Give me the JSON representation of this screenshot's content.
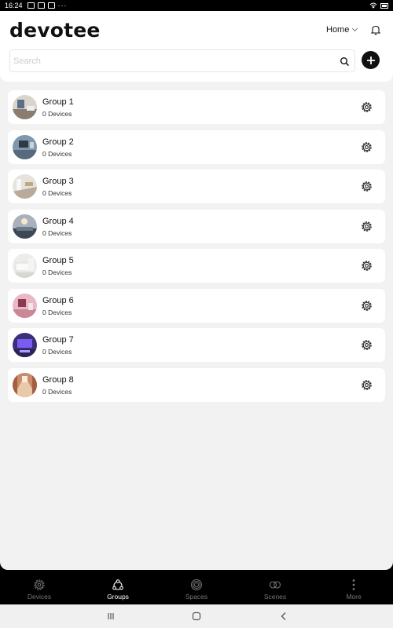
{
  "status_bar": {
    "time": "16:24"
  },
  "app": {
    "logo": "devotee"
  },
  "header": {
    "home_label": "Home",
    "search_placeholder": "Search"
  },
  "groups": [
    {
      "name": "Group 1",
      "count": "0 Devices"
    },
    {
      "name": "Group 2",
      "count": "0 Devices"
    },
    {
      "name": "Group 3",
      "count": "0 Devices"
    },
    {
      "name": "Group 4",
      "count": "0 Devices"
    },
    {
      "name": "Group 5",
      "count": "0 Devices"
    },
    {
      "name": "Group 6",
      "count": "0 Devices"
    },
    {
      "name": "Group 7",
      "count": "0 Devices"
    },
    {
      "name": "Group 8",
      "count": "0 Devices"
    }
  ],
  "nav": [
    {
      "label": "Devices",
      "icon": "gear-icon",
      "active": false
    },
    {
      "label": "Groups",
      "icon": "groups-icon",
      "active": true
    },
    {
      "label": "Spaces",
      "icon": "spaces-icon",
      "active": false
    },
    {
      "label": "Scenes",
      "icon": "scenes-icon",
      "active": false
    },
    {
      "label": "More",
      "icon": "more-icon",
      "active": false
    }
  ],
  "colors": {
    "accent": "#111111",
    "background": "#f2f2f2",
    "nav_bg": "#000000"
  }
}
